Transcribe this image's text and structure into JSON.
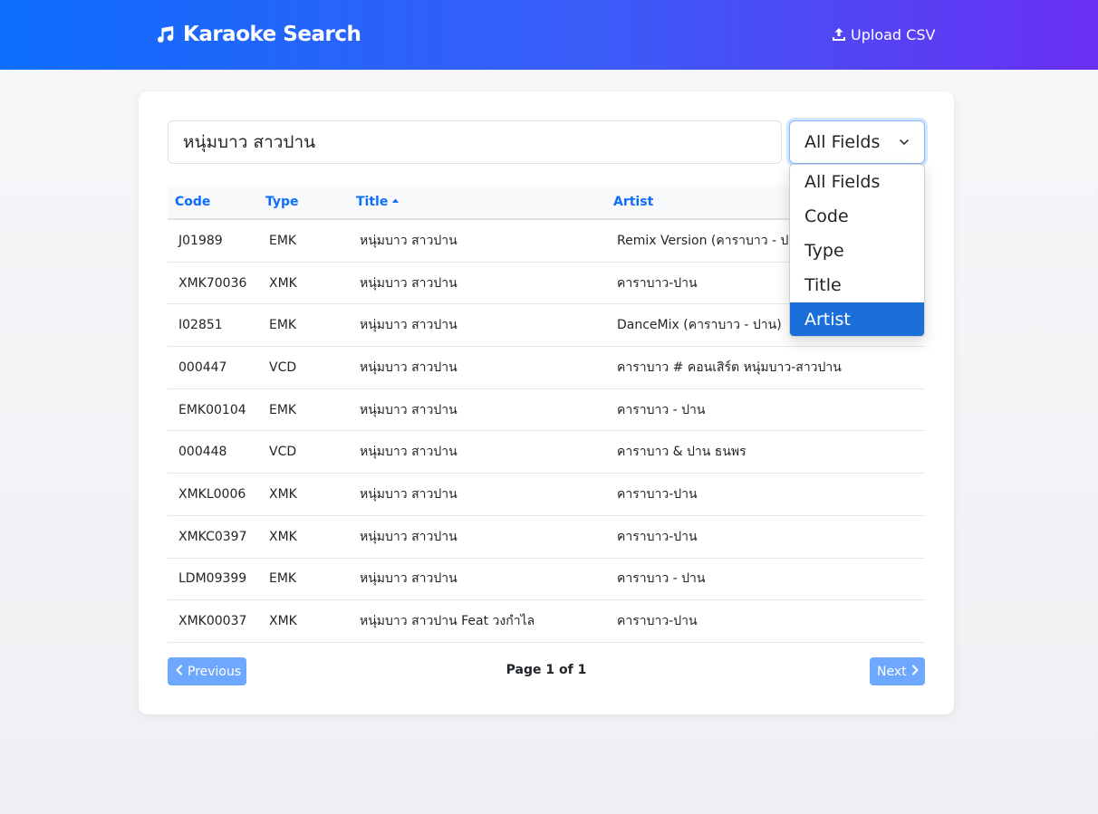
{
  "navbar": {
    "brand_icon": "music-note-icon",
    "brand": "Karaoke Search",
    "upload_icon": "upload-icon",
    "upload_label": "Upload CSV"
  },
  "search": {
    "value": "หนุ่มบาว สาวปาน",
    "field_selected": "All Fields",
    "field_options": [
      "All Fields",
      "Code",
      "Type",
      "Title",
      "Artist"
    ],
    "highlighted_option": "Artist"
  },
  "table": {
    "headers": [
      "Code",
      "Type",
      "Title",
      "Artist"
    ],
    "sort_column": "Title",
    "sort_direction": "ascending",
    "rows": [
      [
        "J01989",
        "EMK",
        "หนุ่มบาว สาวปาน",
        "Remix Version (คาราบาว - ปาน)"
      ],
      [
        "XMK70036",
        "XMK",
        "หนุ่มบาว สาวปาน",
        "คาราบาว-ปาน"
      ],
      [
        "I02851",
        "EMK",
        "หนุ่มบาว สาวปาน",
        "DanceMix (คาราบาว - ปาน)"
      ],
      [
        "000447",
        "VCD",
        "หนุ่มบาว สาวปาน",
        "คาราบาว # คอนเสิร์ต หนุ่มบาว-สาวปาน"
      ],
      [
        "EMK00104",
        "EMK",
        "หนุ่มบาว สาวปาน",
        "คาราบาว - ปาน"
      ],
      [
        "000448",
        "VCD",
        "หนุ่มบาว สาวปาน",
        "คาราบาว & ปาน ธนพร"
      ],
      [
        "XMKL0006",
        "XMK",
        "หนุ่มบาว สาวปาน",
        "คาราบาว-ปาน"
      ],
      [
        "XMKC0397",
        "XMK",
        "หนุ่มบาว สาวปาน",
        "คาราบาว-ปาน"
      ],
      [
        "LDM09399",
        "EMK",
        "หนุ่มบาว สาวปาน",
        "คาราบาว - ปาน"
      ],
      [
        "XMK00037",
        "XMK",
        "หนุ่มบาว สาวปาน Feat วงกำไล",
        "คาราบาว-ปาน"
      ]
    ]
  },
  "pagination": {
    "previous_label": "Previous",
    "next_label": "Next",
    "page_info": "Page 1 of 1"
  },
  "colors": {
    "primary": "#0d6efd",
    "gradient_end": "#6a2ff2",
    "disabled_button": "#6ea8fe",
    "option_highlight": "#1a6fd8"
  }
}
